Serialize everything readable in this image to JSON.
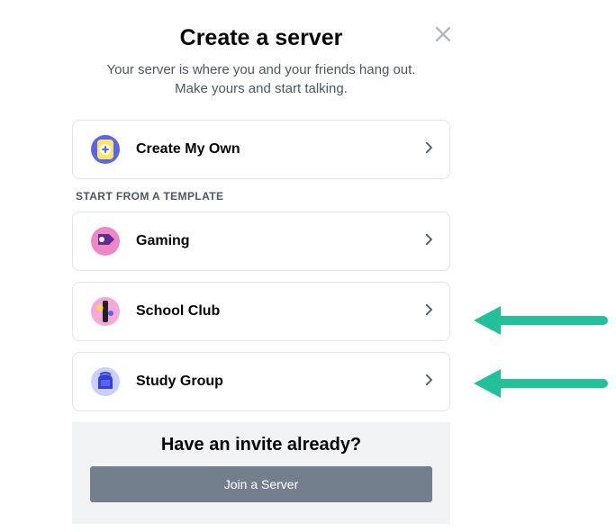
{
  "modal": {
    "title": "Create a server",
    "subtitle": "Your server is where you and your friends hang out. Make yours and start talking.",
    "close_icon": "close"
  },
  "options": {
    "create_own": "Create My Own"
  },
  "templates": {
    "header": "START FROM A TEMPLATE",
    "items": [
      {
        "label": "Gaming"
      },
      {
        "label": "School Club"
      },
      {
        "label": "Study Group"
      }
    ]
  },
  "footer": {
    "title": "Have an invite already?",
    "join_label": "Join a Server"
  },
  "annotation": {
    "arrow_color": "#21c19a"
  }
}
